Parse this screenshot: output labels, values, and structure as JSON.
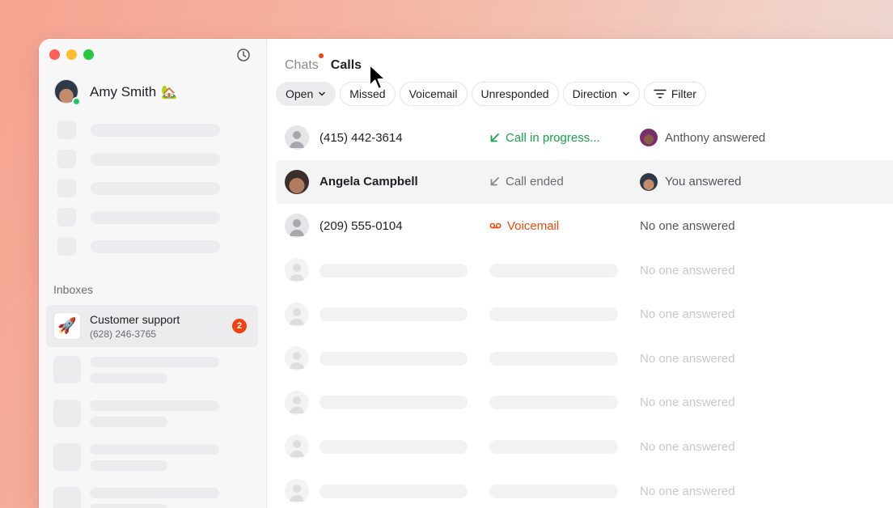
{
  "sidebar": {
    "user": {
      "name": "Amy Smith",
      "emoji": "🏡",
      "status": "online"
    },
    "inboxes_label": "Inboxes",
    "inbox": {
      "name": "Customer support",
      "phone": "(628) 246-3765",
      "badge": "2",
      "icon": "rocket-emoji",
      "emoji": "🚀"
    }
  },
  "tabs": [
    {
      "label": "Chats",
      "active": false,
      "has_dot": true
    },
    {
      "label": "Calls",
      "active": true
    }
  ],
  "filters": [
    {
      "label": "Open",
      "dropdown": true,
      "selected": true
    },
    {
      "label": "Missed"
    },
    {
      "label": "Voicemail"
    },
    {
      "label": "Unresponded"
    },
    {
      "label": "Direction",
      "dropdown": true
    },
    {
      "label": "Filter",
      "icon": "filter-icon"
    }
  ],
  "calls": [
    {
      "name": "(415) 442-3614",
      "status": "Call in progress...",
      "status_color": "#16a34a",
      "answer": "Anthony answered"
    },
    {
      "name": "Angela Campbell",
      "status": "Call ended",
      "status_color": "#6b6b72",
      "answer": "You answered"
    },
    {
      "name": "(209) 555-0104",
      "status": "Voicemail",
      "status_color": "#ea4c0f",
      "answer": "No one answered"
    }
  ],
  "placeholder_answer": "No one answered",
  "colors": {
    "accent": "#f0420e",
    "online": "#22c55e"
  }
}
